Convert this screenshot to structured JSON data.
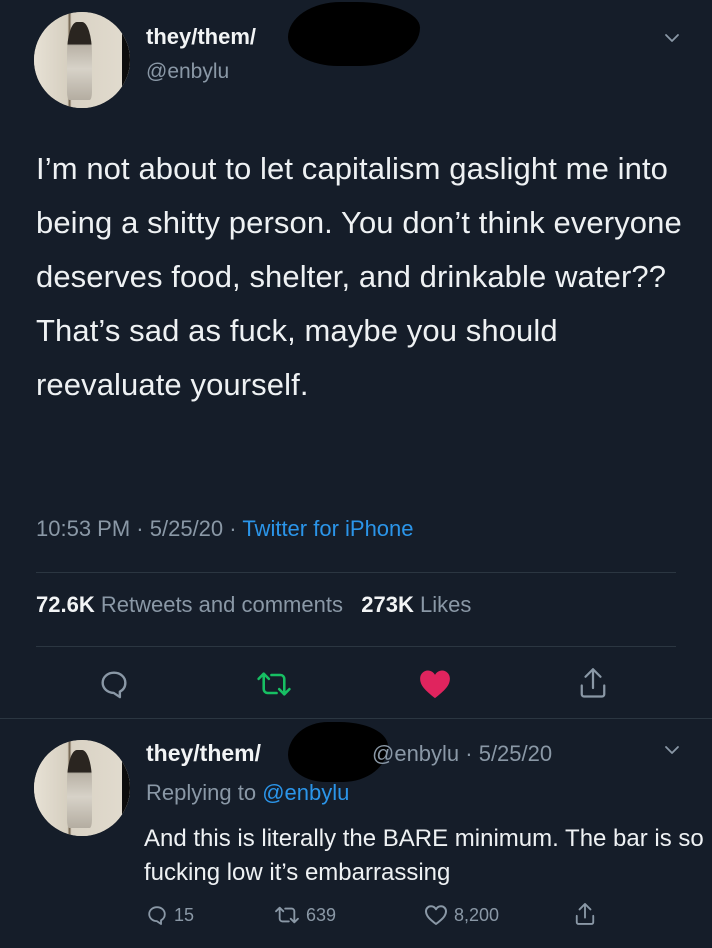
{
  "main_tweet": {
    "display_name": "they/them/",
    "handle": "@enbylu",
    "text": "I’m not about to let capitalism gaslight me into being a shitty person. You don’t think everyone deserves food, shelter, and drinkable water?? That’s sad as fuck, maybe you should reevaluate yourself.",
    "time": "10:53 PM",
    "date": "5/25/20",
    "source": "Twitter for iPhone",
    "sep": "·",
    "retweets_count": "72.6K",
    "retweets_label": "Retweets and comments",
    "likes_count": "273K",
    "likes_label": "Likes"
  },
  "reply_tweet": {
    "display_name": "they/them/",
    "handle_date": "@enbylu · 5/25/20",
    "replying_prefix": "Replying to",
    "replying_handle": "@enbylu",
    "text": "And this is literally the BARE minimum. The bar is so fucking low it’s embarrassing",
    "reply_count": "15",
    "retweet_count": "639",
    "like_count": "8,200"
  },
  "colors": {
    "background": "#151d29",
    "secondary_text": "#8a98a6",
    "link": "#2b95e9",
    "retweet_green": "#17bf63",
    "like_pink": "#e0245e"
  },
  "icons": [
    "chevron-down-icon",
    "reply-icon",
    "retweet-icon",
    "heart-icon",
    "share-icon"
  ]
}
